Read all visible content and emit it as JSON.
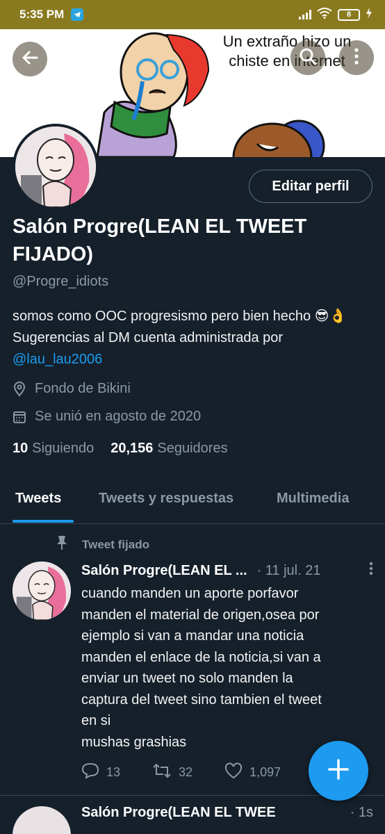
{
  "status_bar": {
    "time": "5:35 PM",
    "battery": "8"
  },
  "header": {
    "banner_caption": "Un extraño hizo un chiste en internet",
    "back_icon": "arrow-left-icon",
    "search_icon": "search-icon",
    "more_icon": "more-vertical-icon"
  },
  "profile": {
    "edit_label": "Editar perfil",
    "name": "Salón Progre(LEAN EL TWEET FIJADO)",
    "handle": "@Progre_idiots",
    "bio_text": "somos como OOC progresismo pero bien hecho 😎👌  Sugerencias al DM  cuenta administrada por ",
    "bio_link": "@lau_lau2006",
    "location": "Fondo de Bikini",
    "joined": "Se unió en agosto de 2020",
    "following_count": "10",
    "following_label": "Siguiendo",
    "followers_count": "20,156",
    "followers_label": "Seguidores"
  },
  "tabs": [
    {
      "label": "Tweets",
      "active": true
    },
    {
      "label": "Tweets y respuestas",
      "active": false
    },
    {
      "label": "Multimedia",
      "active": false
    }
  ],
  "pinned_tweet": {
    "pinned_label": "Tweet fijado",
    "author": "Salón Progre(LEAN EL ...",
    "date": "· 11 jul. 21",
    "text_lines": [
      "cuando manden un aporte porfavor",
      "manden el material de origen,osea por",
      "ejemplo si van a mandar una noticia",
      "manden el enlace de la noticia,si van a",
      "enviar un tweet no solo manden la",
      "captura del tweet sino tambien el tweet",
      "en si",
      "mushas grashias"
    ],
    "replies": "13",
    "retweets": "32",
    "likes": "1,097"
  },
  "next_tweet": {
    "author": "Salón Progre(LEAN EL TWEE",
    "date": "· 1s"
  },
  "colors": {
    "background": "#15202b",
    "accent": "#1d9bf0",
    "muted": "#8b98a5",
    "status_bar": "#8a7a1f"
  }
}
